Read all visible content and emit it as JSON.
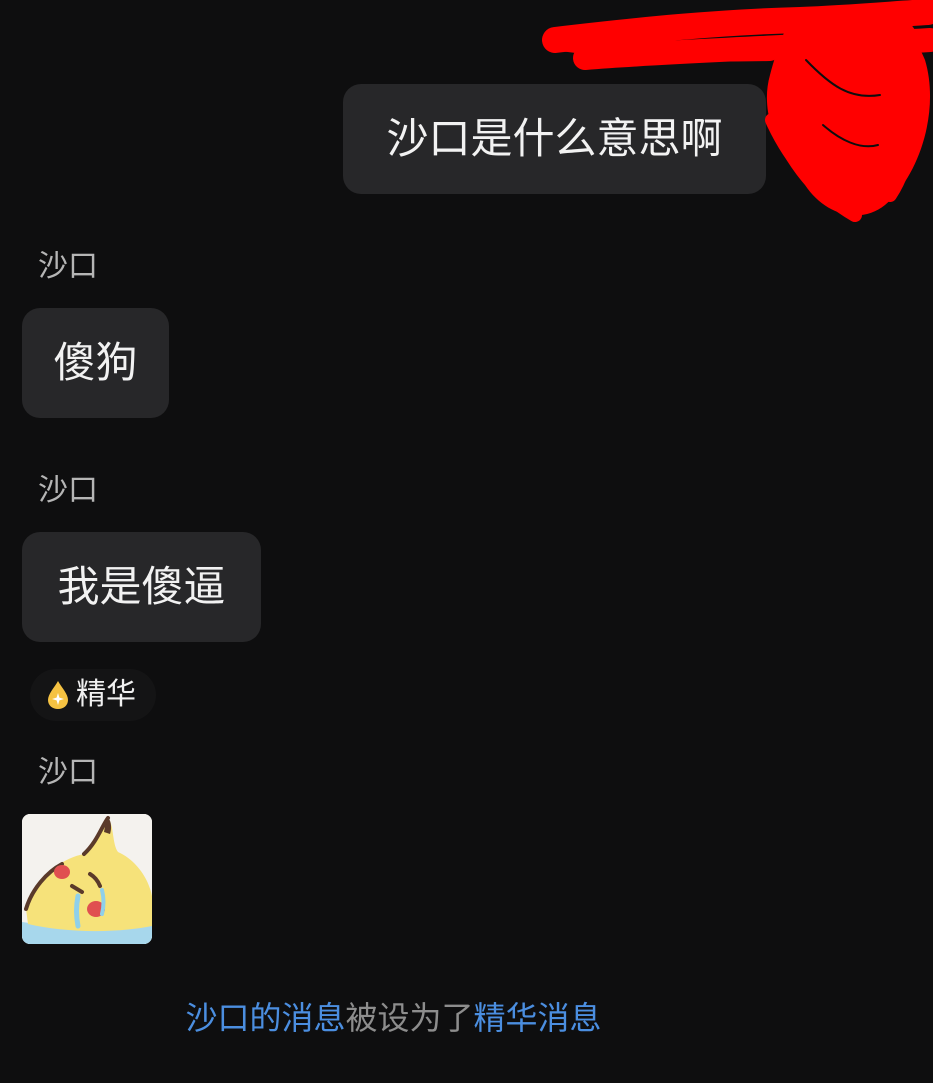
{
  "messages": {
    "outgoing": {
      "text": "沙口是什么意思啊"
    },
    "incoming": [
      {
        "sender": "沙口",
        "text": "傻狗"
      },
      {
        "sender": "沙口",
        "text": "我是傻逼"
      },
      {
        "sender": "沙口",
        "sticker": "crying-pikachu-sticker"
      }
    ]
  },
  "essence_tag": {
    "icon": "gold-drop-star-icon",
    "label": "精华"
  },
  "system_notice": {
    "part1": "沙口的消息",
    "part2": "被设为了",
    "part3": "精华消息"
  },
  "colors": {
    "background": "#0e0e0f",
    "bubble": "#272729",
    "link": "#4b8ee0",
    "redaction": "#ff0000",
    "essence_icon": "#f5c242"
  }
}
